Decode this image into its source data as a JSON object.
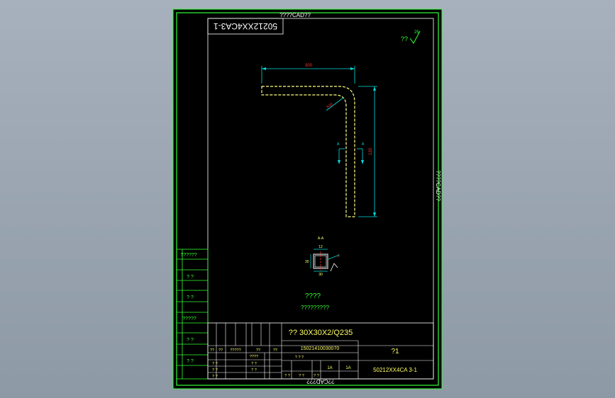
{
  "sheet": {
    "top_label": "????CAD??",
    "bottom_label": "??CAD???",
    "side_label": "????CAD??",
    "drawing_no_rotated": "50212XX4CA3-1"
  },
  "roughness": {
    "prefix": "??",
    "value": "25"
  },
  "part": {
    "dim_length": "300",
    "dim_height": "120",
    "dim_radius": "R20",
    "section_mark": "A",
    "section_label": "A-A",
    "section_top_dim": "12",
    "section_left_dim": "30",
    "section_bottom_dim": "30",
    "section_side_dim": "2",
    "note_title": "????",
    "note_text": "?????????"
  },
  "side_table": {
    "rows": [
      "??????",
      "? ?",
      "? ?",
      "?????",
      "? ?",
      "? ?"
    ]
  },
  "title_block": {
    "material": "?? 30X30X2/Q235",
    "part_code": "15021410030070",
    "scale": "?1",
    "drawing_no": "50212XX4CA 3-1",
    "col_headers": [
      "??",
      "??",
      "?????",
      "??",
      "??"
    ],
    "row_labels": [
      "? ?",
      "? ?",
      "? ?"
    ],
    "mid_cells": [
      "????",
      "? ?",
      "? ?"
    ],
    "sign_cells": [
      "? ? ?",
      "? ?",
      "? ?",
      "? ?"
    ],
    "qty_a": "1A",
    "qty_b": "1A"
  },
  "colors": {
    "sheet_bg": "#000000",
    "frame": "#33ff33",
    "border": "#ffffff",
    "part_line": "#ffff66",
    "dimension": "#00dddd",
    "dim_text": "#ff3333"
  }
}
